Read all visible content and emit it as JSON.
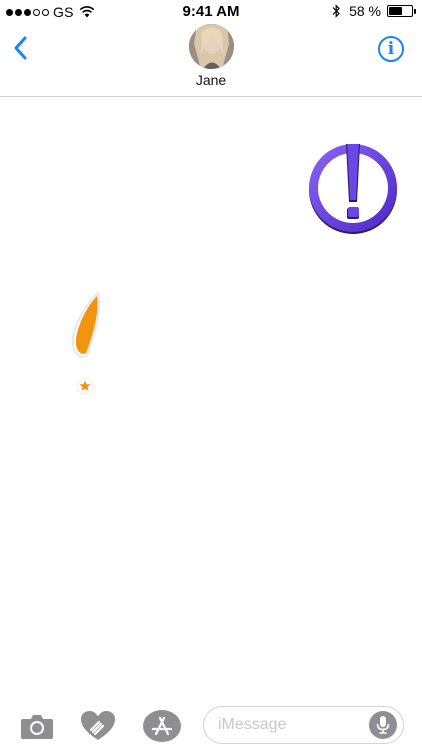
{
  "status_bar": {
    "signal_dots_filled": 3,
    "signal_dots_total": 5,
    "carrier": "GS",
    "time": "9:41 AM",
    "battery_percent": "58 %",
    "battery_level": 0.58
  },
  "header": {
    "contact_name": "Jane",
    "back_icon": "chevron-left-icon",
    "info_icon": "info-icon"
  },
  "conversation": {
    "stickers": [
      {
        "name": "exclamation-circle-sticker",
        "colors": [
          "#5a35d8",
          "#8a66f5"
        ]
      },
      {
        "name": "feather-exclamation-sticker",
        "colors": [
          "#f29410"
        ]
      }
    ]
  },
  "input_bar": {
    "placeholder": "iMessage",
    "camera_icon": "camera-icon",
    "digital_touch_icon": "digital-touch-heart-icon",
    "appstore_icon": "app-store-icon",
    "mic_icon": "microphone-icon"
  },
  "colors": {
    "accent": "#1a82fb",
    "icon_gray": "#8e8e93",
    "divider": "#cfcfd2"
  }
}
